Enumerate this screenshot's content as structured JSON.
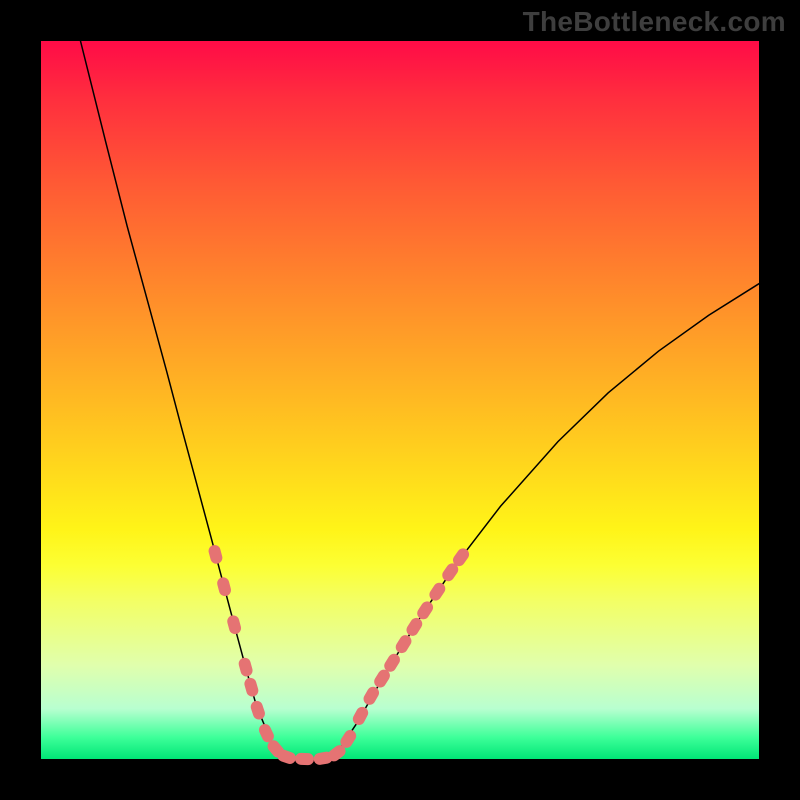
{
  "watermark": "TheBottleneck.com",
  "chart_data": {
    "type": "line",
    "title": "",
    "xlabel": "",
    "ylabel": "",
    "xlim": [
      0,
      1
    ],
    "ylim": [
      0,
      1
    ],
    "notes": "V-shaped curve on rainbow gradient background; no axis ticks or numeric labels are rendered.",
    "series": [
      {
        "name": "left-branch",
        "x": [
          0.055,
          0.09,
          0.12,
          0.15,
          0.175,
          0.195,
          0.215,
          0.237,
          0.255,
          0.272,
          0.286,
          0.3,
          0.32,
          0.345
        ],
        "y": [
          1.0,
          0.86,
          0.742,
          0.632,
          0.54,
          0.464,
          0.39,
          0.308,
          0.24,
          0.176,
          0.124,
          0.074,
          0.026,
          0.0
        ]
      },
      {
        "name": "valley-floor",
        "x": [
          0.345,
          0.38,
          0.408
        ],
        "y": [
          0.0,
          0.0,
          0.002
        ]
      },
      {
        "name": "right-branch",
        "x": [
          0.408,
          0.44,
          0.48,
          0.53,
          0.58,
          0.64,
          0.72,
          0.79,
          0.86,
          0.93,
          1.0
        ],
        "y": [
          0.002,
          0.05,
          0.12,
          0.2,
          0.274,
          0.352,
          0.442,
          0.51,
          0.568,
          0.618,
          0.662
        ]
      }
    ],
    "markers": {
      "name": "pink-beads",
      "note": "Elongated pink segments along lower portion of curve",
      "points": [
        {
          "x": 0.243,
          "y": 0.285
        },
        {
          "x": 0.255,
          "y": 0.24
        },
        {
          "x": 0.269,
          "y": 0.187
        },
        {
          "x": 0.285,
          "y": 0.128
        },
        {
          "x": 0.293,
          "y": 0.1
        },
        {
          "x": 0.302,
          "y": 0.068
        },
        {
          "x": 0.314,
          "y": 0.036
        },
        {
          "x": 0.327,
          "y": 0.014
        },
        {
          "x": 0.342,
          "y": 0.003
        },
        {
          "x": 0.367,
          "y": 0.0
        },
        {
          "x": 0.393,
          "y": 0.001
        },
        {
          "x": 0.412,
          "y": 0.008
        },
        {
          "x": 0.428,
          "y": 0.028
        },
        {
          "x": 0.445,
          "y": 0.06
        },
        {
          "x": 0.46,
          "y": 0.088
        },
        {
          "x": 0.475,
          "y": 0.112
        },
        {
          "x": 0.489,
          "y": 0.134
        },
        {
          "x": 0.505,
          "y": 0.16
        },
        {
          "x": 0.52,
          "y": 0.184
        },
        {
          "x": 0.535,
          "y": 0.207
        },
        {
          "x": 0.552,
          "y": 0.233
        },
        {
          "x": 0.57,
          "y": 0.26
        },
        {
          "x": 0.585,
          "y": 0.281
        }
      ]
    }
  }
}
